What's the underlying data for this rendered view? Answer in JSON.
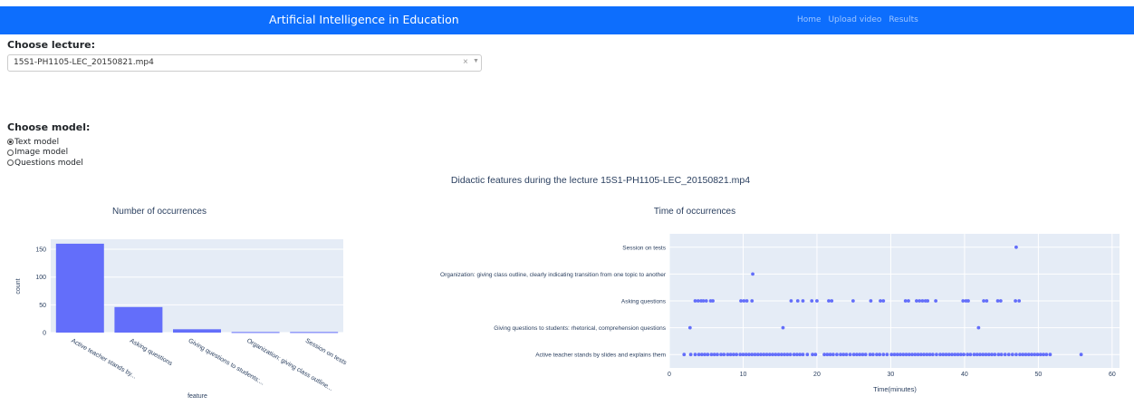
{
  "header": {
    "title": "Artificial Intelligence in Education",
    "nav": [
      "Home",
      "Upload video",
      "Results"
    ]
  },
  "lecture": {
    "label": "Choose lecture:",
    "selected": "15S1-PH1105-LEC_20150821.mp4",
    "clear_glyph": "×",
    "arrow_glyph": "▼"
  },
  "model": {
    "label": "Choose model:",
    "options": [
      "Text model",
      "Image model",
      "Questions model"
    ],
    "selected_index": 0
  },
  "figure_title": "Didactic features during the lecture 15S1-PH1105-LEC_20150821.mp4",
  "chart_data": [
    {
      "type": "bar",
      "title": "Number of occurrences",
      "xlabel": "feature",
      "ylabel": "count",
      "categories": [
        "Active teacher stands by...",
        "Asking questions",
        "Giving questions to students:...",
        "Organization: giving class outline...",
        "Session on tests"
      ],
      "values": [
        160,
        46,
        6,
        1,
        1
      ],
      "ylim": [
        0,
        168
      ],
      "yticks": [
        0,
        50,
        100,
        150
      ],
      "color": "#636efa",
      "background": "#e5ecf6"
    },
    {
      "type": "scatter",
      "title": "Time of occurrences",
      "xlabel": "Time(minutes)",
      "ylabel": "",
      "xlim": [
        0,
        61
      ],
      "xticks": [
        0,
        10,
        20,
        30,
        40,
        50,
        60
      ],
      "categories": [
        "Active teacher stands by slides and explains them",
        "Giving questions to students: rhetorical, comprehension questions",
        "Asking questions",
        "Organization: giving class outline, clearly indicating transition from one topic to another",
        "Session on tests"
      ],
      "series": [
        {
          "category": "Session on tests",
          "x": [
            47.0
          ]
        },
        {
          "category": "Organization: giving class outline, clearly indicating transition from one topic to another",
          "x": [
            11.3
          ]
        },
        {
          "category": "Asking questions",
          "x": [
            3.5,
            3.9,
            4.3,
            4.6,
            5.0,
            5.6,
            5.9,
            9.7,
            10.1,
            10.5,
            11.2,
            16.5,
            17.4,
            18.1,
            19.3,
            20.0,
            21.6,
            22.0,
            24.9,
            27.3,
            28.6,
            29.0,
            32.0,
            32.4,
            33.5,
            33.9,
            34.3,
            34.7,
            35.0,
            36.1,
            39.8,
            40.2,
            40.5,
            42.6,
            43.0,
            44.5,
            44.9,
            46.9,
            47.4
          ]
        },
        {
          "category": "Giving questions to students: rhetorical, comprehension questions",
          "x": [
            2.8,
            15.4,
            41.9
          ]
        },
        {
          "category": "Active teacher stands by slides and explains them",
          "x": [
            2.0,
            2.9,
            3.5,
            4.0,
            4.4,
            4.8,
            5.2,
            5.7,
            6.1,
            6.5,
            7.0,
            7.4,
            7.9,
            8.3,
            8.7,
            9.1,
            9.6,
            10.0,
            10.4,
            10.8,
            11.2,
            11.6,
            12.0,
            12.4,
            12.8,
            13.2,
            13.6,
            14.0,
            14.4,
            14.8,
            15.2,
            15.6,
            16.0,
            16.4,
            16.9,
            17.3,
            17.7,
            18.1,
            18.7,
            19.4,
            19.8,
            21.0,
            21.4,
            21.8,
            22.2,
            22.7,
            23.2,
            23.6,
            24.0,
            24.5,
            25.0,
            25.4,
            25.8,
            26.2,
            26.6,
            27.2,
            27.6,
            28.1,
            28.5,
            29.0,
            29.5,
            30.1,
            30.5,
            30.9,
            31.3,
            31.7,
            32.1,
            32.5,
            32.9,
            33.3,
            33.7,
            34.1,
            34.5,
            34.9,
            35.3,
            35.7,
            36.2,
            36.7,
            37.1,
            37.5,
            37.9,
            38.3,
            38.7,
            39.1,
            39.5,
            39.9,
            40.4,
            40.8,
            41.3,
            41.7,
            42.1,
            42.5,
            42.9,
            43.3,
            43.7,
            44.1,
            44.6,
            45.0,
            45.5,
            46.0,
            46.5,
            47.0,
            47.5,
            47.9,
            48.3,
            48.7,
            49.1,
            49.5,
            49.9,
            50.3,
            50.7,
            51.1,
            51.6,
            55.8
          ]
        }
      ],
      "color": "#636efa",
      "background": "#e5ecf6"
    }
  ]
}
